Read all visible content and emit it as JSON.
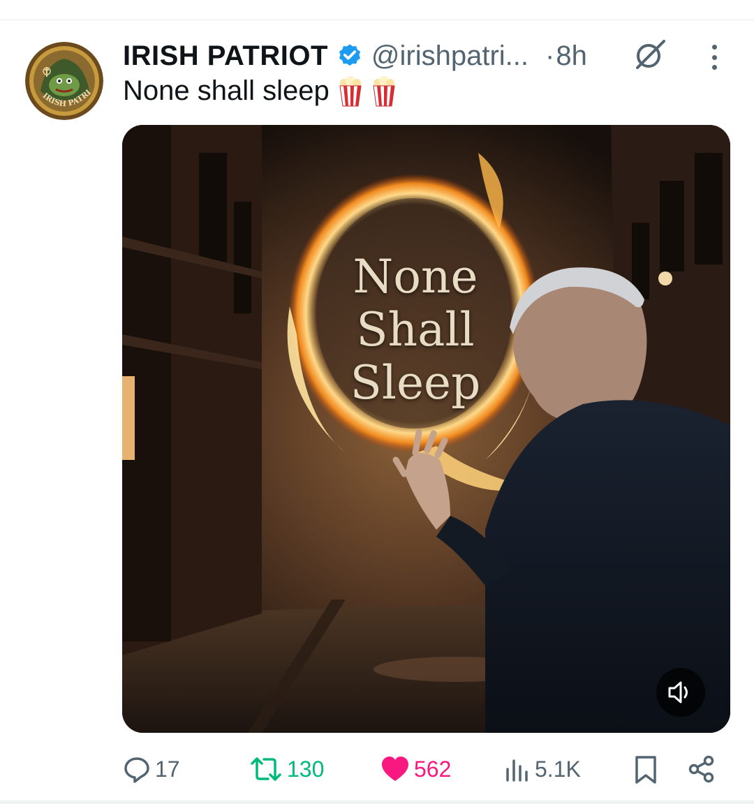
{
  "post": {
    "author": {
      "display_name": "IRISH PATRIOT",
      "verified": true,
      "handle": "@irishpatri...",
      "avatar_text": "IRISH PATRIOT",
      "avatar_icon": "frog-in-hood-avatar"
    },
    "separator": "·",
    "time": "8h",
    "text": "None shall sleep",
    "emojis": [
      "popcorn",
      "popcorn"
    ],
    "media": {
      "type": "video",
      "overlay_text": [
        "None",
        "Shall",
        "Sleep"
      ],
      "mute_icon": "volume-icon"
    },
    "actions": {
      "replies": "17",
      "reposts": "130",
      "likes": "562",
      "views": "5.1K"
    }
  },
  "colors": {
    "text_primary": "#0f1419",
    "text_secondary": "#536471",
    "verified_blue": "#1d9bf0",
    "repost_green": "#00ba7c",
    "like_pink": "#f91880"
  },
  "icons": [
    "grok-icon",
    "more-icon",
    "reply-icon",
    "repost-icon",
    "heart-icon",
    "views-icon",
    "bookmark-icon",
    "share-icon"
  ]
}
